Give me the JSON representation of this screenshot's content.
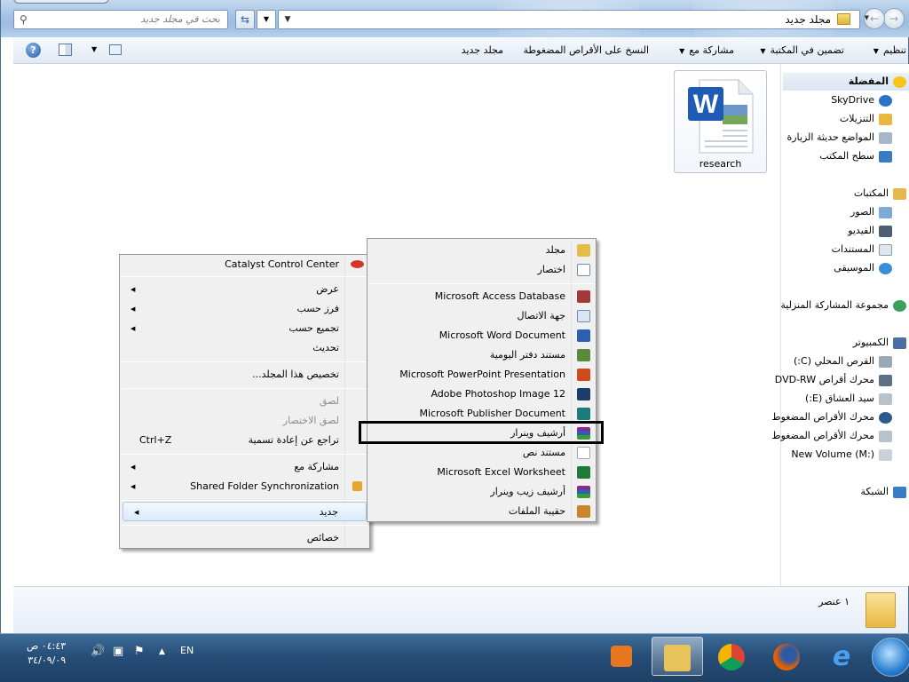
{
  "window": {
    "address_path": "مجلد جديد",
    "search_placeholder": "بحث في مجلد جديد"
  },
  "toolbar": {
    "organize": "تنظيم",
    "include_in_library": "تضمين في المكتبة",
    "share_with": "مشاركة مع",
    "burn": "النسخ على الأقراص المضغوطة",
    "new_folder": "مجلد جديد"
  },
  "nav_pane": {
    "favorites": "المفضلة",
    "skydrive": "SkyDrive",
    "downloads": "التنزيلات",
    "recent_places": "المواضع حديثة الزيارة",
    "desktop": "سطح المكتب",
    "libraries": "المكتبات",
    "pictures": "الصور",
    "videos": "الفيديو",
    "documents": "المستندات",
    "music": "الموسيقى",
    "homegroup": "مجموعة المشاركة المنزلية",
    "computer": "الكمبيوتر",
    "local_disk": "القرص المحلي (C:)",
    "dvd_rw": "محرك أقراص DVD-RW",
    "drive_e": "سيد العشاق (E:)",
    "cd_drive_1": "محرك الأقراص المضغوط",
    "cd_drive_2": "محرك الأقراص المضغوط",
    "new_volume": "New Volume (M:)",
    "network": "الشبكة"
  },
  "content": {
    "files": [
      {
        "name": "research"
      }
    ]
  },
  "details": {
    "item_count": "١ عنصر"
  },
  "context_menu": {
    "catalyst": "Catalyst Control Center",
    "view": "عرض",
    "sort_by": "فرز حسب",
    "group_by": "تجميع حسب",
    "refresh": "تحديث",
    "customize": "تخصيص هذا المجلد...",
    "paste": "لصق",
    "paste_shortcut": "لصق الاختصار",
    "undo_rename": "تراجع عن إعادة تسمية",
    "undo_shortcut": "Ctrl+Z",
    "share_with": "مشاركة مع",
    "shared_folder_sync": "Shared Folder Synchronization",
    "new": "جديد",
    "properties": "خصائص"
  },
  "new_submenu": {
    "folder": "مجلد",
    "shortcut": "اختصار",
    "access_db": "Microsoft Access Database",
    "contact": "جهة الاتصال",
    "word_doc": "Microsoft Word Document",
    "journal": "مستند دفتر اليومية",
    "powerpoint": "Microsoft PowerPoint Presentation",
    "photoshop": "Adobe Photoshop Image 12",
    "publisher": "Microsoft Publisher Document",
    "winrar_archive": "أرشيف وينرار",
    "text_doc": "مستند نص",
    "excel": "Microsoft Excel Worksheet",
    "winrar_zip": "أرشيف زيب وينرار",
    "briefcase": "حقيبة الملفات"
  },
  "taskbar": {
    "time": "٠٤:٤٣ ص",
    "date": "٣٤/٠٩/٠٩",
    "language": "EN"
  }
}
